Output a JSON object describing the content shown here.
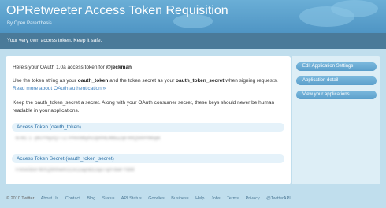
{
  "header": {
    "title": "OPRetweeter Access Token Requisition",
    "byline": "By Open Parenthesis"
  },
  "notice": "Your very own access token. Keep it safe.",
  "main": {
    "intro_prefix": "Here's your OAuth 1.0a access token for ",
    "username": "@jeckman",
    "usage_1": "Use the token string as your ",
    "oauth_token_term": "oauth_token",
    "usage_2": " and the token secret as your ",
    "oauth_token_secret_term": "oauth_token_secret",
    "usage_3": " when signing requests. ",
    "oauth_link": "Read more about OAuth authentication »",
    "warning": "Keep the oauth_token_secret a secret. Along with your OAuth consumer secret, these keys should never be human readable in your applications.",
    "access_token_label": "Access Token (oauth_token)",
    "access_token_value": "8781 1 -j9UYhjDQ77Z7Pmn9byhs3jRHEMbuZqFmtQ5hPrMspk",
    "access_secret_label": "Access Token Secret (oauth_token_secret)",
    "access_secret_value": "Fnnx0dsFWXQ9hhwm1Ck1zajnBz2qoTq/FbwFYBM"
  },
  "sidebar": {
    "buttons": [
      "Edit Application Settings",
      "Application detail",
      "View your applications"
    ]
  },
  "footer": {
    "copyright": "© 2010 Twitter",
    "links": [
      "About Us",
      "Contact",
      "Blog",
      "Status",
      "API Status",
      "Goodies",
      "Business",
      "Help",
      "Jobs",
      "Terms",
      "Privacy",
      "@TwitterAPI"
    ]
  }
}
